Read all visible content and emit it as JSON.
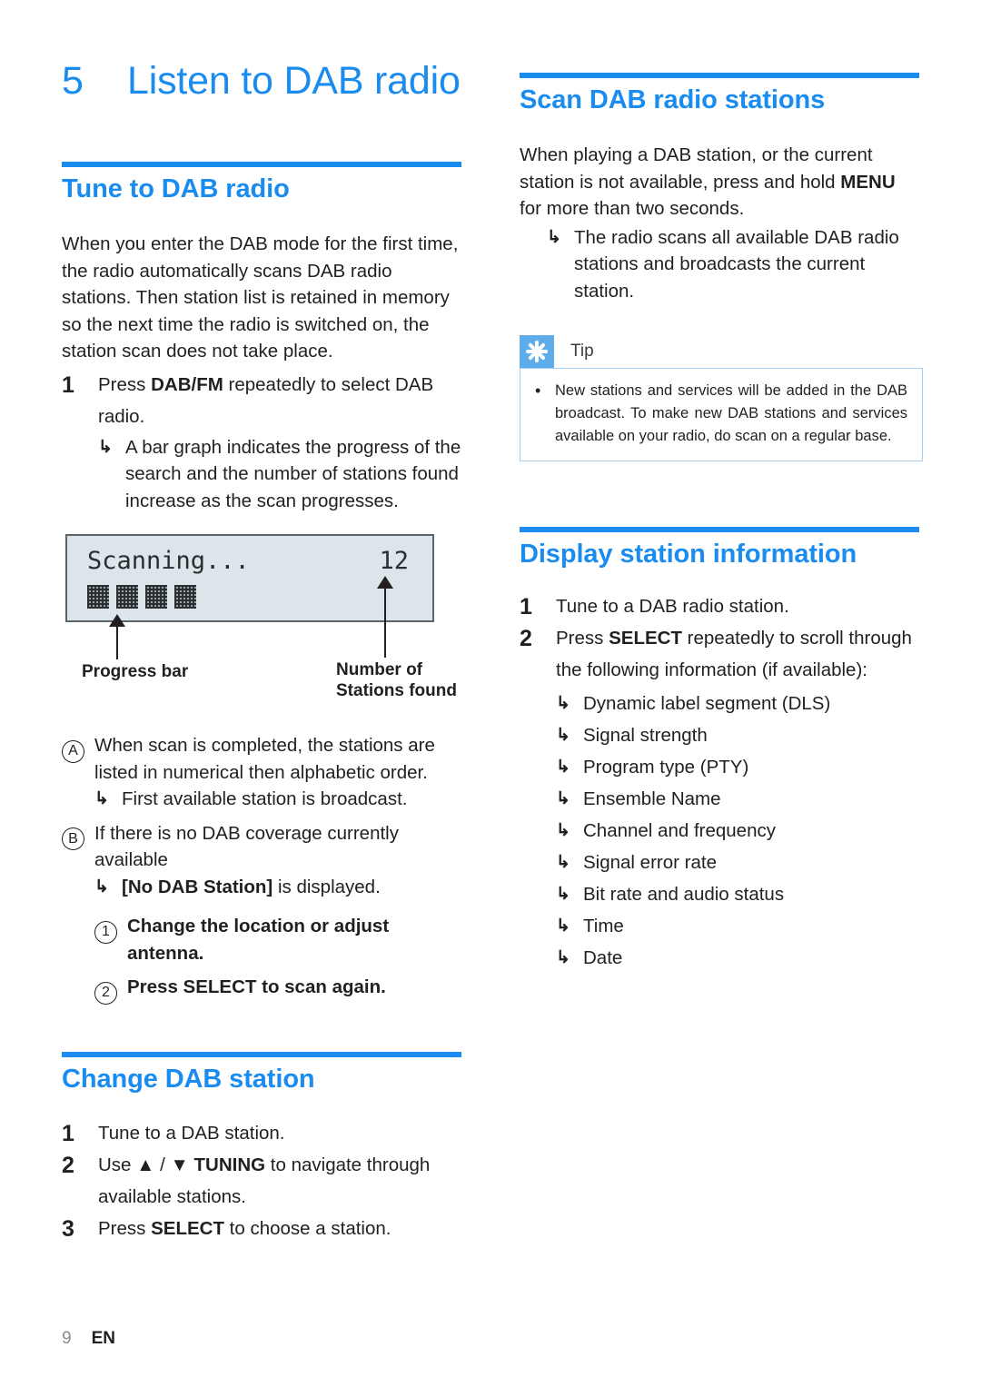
{
  "chapter": {
    "number": "5",
    "title": "Listen to DAB radio"
  },
  "left_column": {
    "section1": {
      "heading": "Tune to DAB radio",
      "intro": "When you enter the DAB mode for the first time, the radio automatically scans DAB radio stations. Then station list is retained in memory so the next time the radio is switched on, the station scan does not take place.",
      "step1": {
        "number": "1",
        "text_before": "Press ",
        "bold": "DAB/FM",
        "text_after": " repeatedly to select DAB radio."
      },
      "step1_sub": {
        "arrow": "↳",
        "text": "A bar graph indicates the progress of the search and the number of stations found increase as the scan progresses."
      },
      "figure": {
        "lcd_text": "Scanning...",
        "lcd_count": "12",
        "progress_blocks": 4,
        "label_left": "Progress bar",
        "label_right_line1": "Number of",
        "label_right_line2": "Stations found"
      },
      "item_a": {
        "marker": "A",
        "text": "When scan is completed, the stations are listed in numerical then alphabetic order.",
        "sub_arrow": "↳",
        "sub_text": "First available station is broadcast."
      },
      "item_b": {
        "marker": "B",
        "text": "If there is no DAB coverage currently available",
        "sub_arrow": "↳",
        "sub_bold": "[No DAB Station]",
        "sub_after": " is displayed."
      },
      "item_b_step1": {
        "marker": "1",
        "text": "Change the location or adjust antenna."
      },
      "item_b_step2": {
        "marker": "2",
        "text": "Press SELECT to scan again."
      }
    },
    "section2": {
      "heading": "Change DAB station",
      "steps": [
        {
          "number": "1",
          "text_before": "Tune to a DAB station.",
          "bold": "",
          "text_after": ""
        },
        {
          "number": "2",
          "text_before": "Use ▲ / ▼ ",
          "bold": "TUNING",
          "text_after": " to navigate through available stations."
        },
        {
          "number": "3",
          "text_before": "Press ",
          "bold": "SELECT",
          "text_after": " to choose a station."
        }
      ]
    }
  },
  "right_column": {
    "section1": {
      "heading": "Scan DAB radio stations",
      "para_before": "When playing a DAB station, or the current station is not available, press and hold ",
      "para_bold": "MENU",
      "para_after": " for more than two seconds.",
      "sub_arrow": "↳",
      "sub_text": "The radio scans all available DAB radio stations and broadcasts the current station."
    },
    "tip": {
      "icon": "asterisk-icon",
      "label": "Tip",
      "bullet": "•",
      "text": "New stations and services will be added in the DAB broadcast. To make new DAB stations and services available on your radio, do scan on a regular base."
    },
    "section2": {
      "heading": "Display station information",
      "step1": {
        "number": "1",
        "text": "Tune to a DAB radio station."
      },
      "step2": {
        "number": "2",
        "text_before": "Press ",
        "bold": "SELECT",
        "text_after": " repeatedly to scroll through the following information (if available):"
      },
      "arrow": "↳",
      "info_items": [
        "Dynamic label segment (DLS)",
        "Signal strength",
        "Program type (PTY)",
        "Ensemble Name",
        "Channel and frequency",
        "Signal error rate",
        "Bit rate and audio status",
        "Time",
        "Date"
      ]
    }
  },
  "footer": {
    "page": "9",
    "language": "EN"
  },
  "colors": {
    "accent_blue": "#1a8cf0",
    "tip_icon_blue": "#5cade9",
    "tip_border": "#a9cdf0",
    "lcd_background": "#dce6ea",
    "lcd_border": "#5b6468",
    "text": "#231f20",
    "footer_page": "#8a8a8a"
  }
}
